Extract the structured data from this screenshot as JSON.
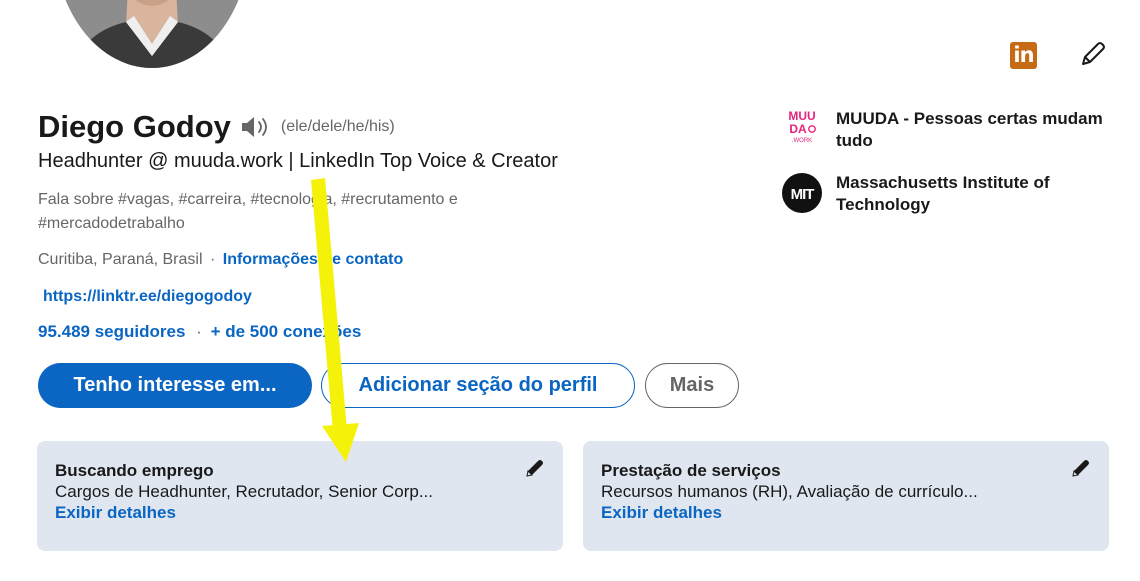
{
  "profile": {
    "name": "Diego Godoy",
    "pronouns": "(ele/dele/he/his)",
    "headline": "Headhunter @ muuda.work | LinkedIn Top Voice & Creator",
    "about": "Fala sobre #vagas, #carreira, #tecnologia, #recrutamento e #mercadodetrabalho",
    "location": "Curitiba, Paraná, Brasil",
    "location_separator": "·",
    "contact_info_label": "Informações de contato",
    "website": "https://linktr.ee/diegogodoy",
    "followers": "95.489 seguidores",
    "stats_separator": "·",
    "connections": "+ de 500 conexões"
  },
  "top_icons": {
    "linkedin_badge": "in",
    "linkedin_badge_icon": "linkedin-icon",
    "edit_icon": "pencil-icon"
  },
  "actions": {
    "primary_label": "Tenho interesse em...",
    "add_section_label": "Adicionar seção do perfil",
    "more_label": "Mais"
  },
  "organizations": [
    {
      "name": "MUUDA - Pessoas certas mudam tudo",
      "logo_icon": "muuda-logo-icon",
      "logo_lines": [
        "MUU",
        "DA",
        ".WORK"
      ]
    },
    {
      "name": "Massachusetts Institute of Technology",
      "logo_icon": "mit-logo-icon",
      "logo_text": "MIT"
    }
  ],
  "cards": [
    {
      "title": "Buscando emprego",
      "description": "Cargos de Headhunter, Recrutador, Senior Corp...",
      "link_label": "Exibir detalhes"
    },
    {
      "title": "Prestação de serviços",
      "description": "Recursos humanos (RH), Avaliação de currículo...",
      "link_label": "Exibir detalhes"
    }
  ],
  "colors": {
    "brand_blue": "#0a66c2",
    "card_bg": "#dfe6f0",
    "muted_text": "#666666",
    "annotation_arrow": "#f5f20a",
    "linkedin_badge_bg": "#c66a13",
    "muuda_logo": "#e5247d"
  }
}
